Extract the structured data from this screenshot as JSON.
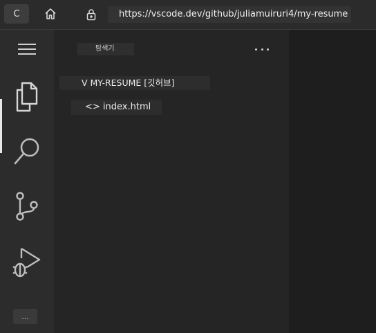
{
  "browser": {
    "tab_letter": "C",
    "url": "https://vscode.dev/github/juliamuiruri4/my-resume",
    "home_icon": "home-icon",
    "lock_icon": "lock-icon"
  },
  "activity_bar": {
    "items": [
      {
        "icon": "menu-icon"
      },
      {
        "icon": "files-icon"
      },
      {
        "icon": "search-icon"
      },
      {
        "icon": "source-control-icon"
      },
      {
        "icon": "run-debug-icon"
      }
    ],
    "accounts_label": "..."
  },
  "sidebar": {
    "title": "탐색기",
    "more_icon": "more-actions-icon",
    "folder_label": "V MY-RESUME [깃허브]",
    "files": [
      {
        "label": "<> index.html"
      }
    ]
  },
  "colors": {
    "activity_bar_bg": "#2c2c2c",
    "sidebar_bg": "#252526",
    "editor_bg": "#1e1e1e",
    "icon_color": "#cfcfcf"
  }
}
